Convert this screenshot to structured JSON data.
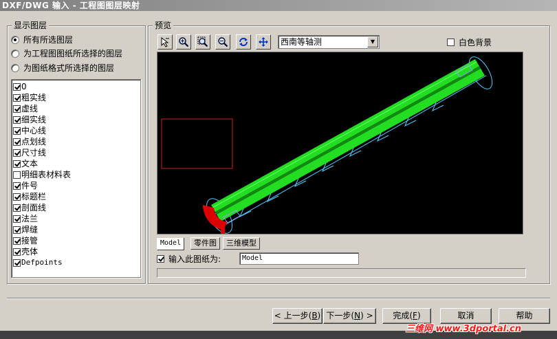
{
  "window": {
    "title": "DXF/DWG 输入 - 工程图图层映射"
  },
  "layers_panel": {
    "title": "显示图层",
    "options": [
      {
        "label": "所有所选图层",
        "selected": true
      },
      {
        "label": "为工程图图纸所选择的图层",
        "selected": false
      },
      {
        "label": "为图纸格式所选择的图层",
        "selected": false
      }
    ],
    "layers": [
      {
        "name": "0",
        "checked": true
      },
      {
        "name": "粗实线",
        "checked": true
      },
      {
        "name": "虚线",
        "checked": true
      },
      {
        "name": "细实线",
        "checked": true
      },
      {
        "name": "中心线",
        "checked": true
      },
      {
        "name": "点划线",
        "checked": true
      },
      {
        "name": "尺寸线",
        "checked": true
      },
      {
        "name": "文本",
        "checked": true
      },
      {
        "name": "明细表材料表",
        "checked": false
      },
      {
        "name": "件号",
        "checked": true
      },
      {
        "name": "标题栏",
        "checked": true
      },
      {
        "name": "剖面线",
        "checked": true
      },
      {
        "name": "法兰",
        "checked": true
      },
      {
        "name": "焊缝",
        "checked": true
      },
      {
        "name": "接管",
        "checked": true
      },
      {
        "name": "壳体",
        "checked": true
      },
      {
        "name": "Defpoints",
        "checked": true
      }
    ]
  },
  "preview_panel": {
    "title": "预览",
    "tool_icons": [
      "select-icon",
      "zoom-in-icon",
      "zoom-window-icon",
      "zoom-out-icon",
      "rotate-icon",
      "pan-icon"
    ],
    "view_select": {
      "selected": "西南等轴测"
    },
    "white_background": {
      "label": "白色背景",
      "checked": false
    },
    "tabs": [
      {
        "label": "Model",
        "active": true
      },
      {
        "label": "零件图",
        "active": false
      },
      {
        "label": "三维模型",
        "active": false
      }
    ],
    "import_sheet": {
      "label": "输入此图纸为:",
      "checked": true,
      "value": "Model"
    }
  },
  "buttons": {
    "back": {
      "label": "< 上一步",
      "key": "B"
    },
    "next": {
      "label": "下一步",
      "key": "N",
      "suffix": " >"
    },
    "finish": {
      "label": "完成",
      "key": "F"
    },
    "cancel": {
      "label": "取消"
    },
    "help": {
      "label": "帮助"
    }
  },
  "watermark": {
    "text": "三维网 www.3dportal.cn"
  },
  "colors": {
    "viewport_bg": "#000000",
    "model_green": "#22dd22",
    "outline_cyan": "#55ccff",
    "selection_red": "#dd0000"
  }
}
